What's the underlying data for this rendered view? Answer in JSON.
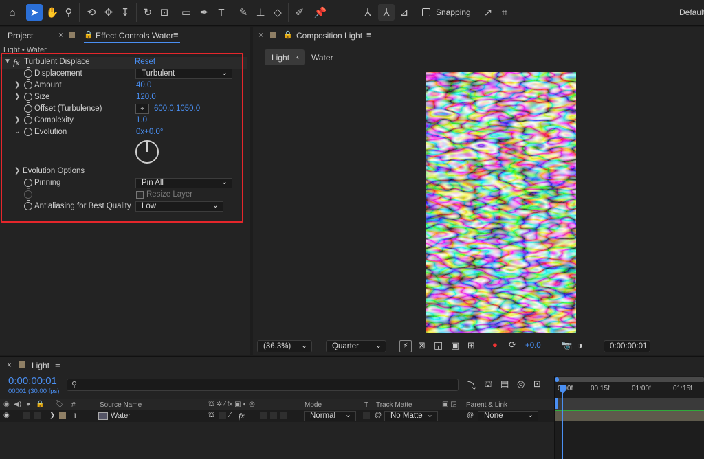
{
  "toolbar": {
    "snapping_label": "Snapping",
    "workspace_label": "Default"
  },
  "effect_controls": {
    "tab_project": "Project",
    "tab_effect_controls": "Effect Controls Water",
    "breadcrumb": "Light • Water",
    "effect": {
      "fx_symbol": "fx",
      "name": "Turbulent Displace",
      "reset_label": "Reset",
      "properties": {
        "displacement": {
          "label": "Displacement",
          "value": "Turbulent"
        },
        "amount": {
          "label": "Amount",
          "value": "40.0"
        },
        "size": {
          "label": "Size",
          "value": "120.0"
        },
        "offset": {
          "label": "Offset (Turbulence)",
          "value": "600.0,1050.0"
        },
        "complexity": {
          "label": "Complexity",
          "value": "1.0"
        },
        "evolution": {
          "label": "Evolution",
          "value": "0x+0.0°"
        },
        "evolution_options": {
          "label": "Evolution Options"
        },
        "pinning": {
          "label": "Pinning",
          "value": "Pin All"
        },
        "resize_layer": {
          "label": "Resize Layer"
        },
        "antialiasing": {
          "label": "Antialiasing for Best Quality",
          "value": "Low"
        }
      }
    }
  },
  "composition": {
    "tab_label": "Composition Light",
    "breadcrumb_active": "Light",
    "breadcrumb_child": "Water",
    "footer": {
      "zoom": "(36.3%)",
      "resolution": "Quarter",
      "exposure": "+0.0",
      "timecode": "0:00:00:01"
    }
  },
  "timeline": {
    "tab_label": "Light",
    "current_time": "0:00:00:01",
    "frame_info": "00001 (30.00 fps)",
    "search_placeholder": "",
    "headers": {
      "num": "#",
      "source_name": "Source Name",
      "mode": "Mode",
      "t": "T",
      "track_matte": "Track Matte",
      "parent_link": "Parent & Link"
    },
    "ruler": [
      "0:00f",
      "00:15f",
      "01:00f",
      "01:15f"
    ],
    "layer": {
      "index": "1",
      "name": "Water",
      "mode": "Normal",
      "track_matte": "No Matte",
      "parent": "None",
      "fx_symbol": "fx"
    }
  }
}
